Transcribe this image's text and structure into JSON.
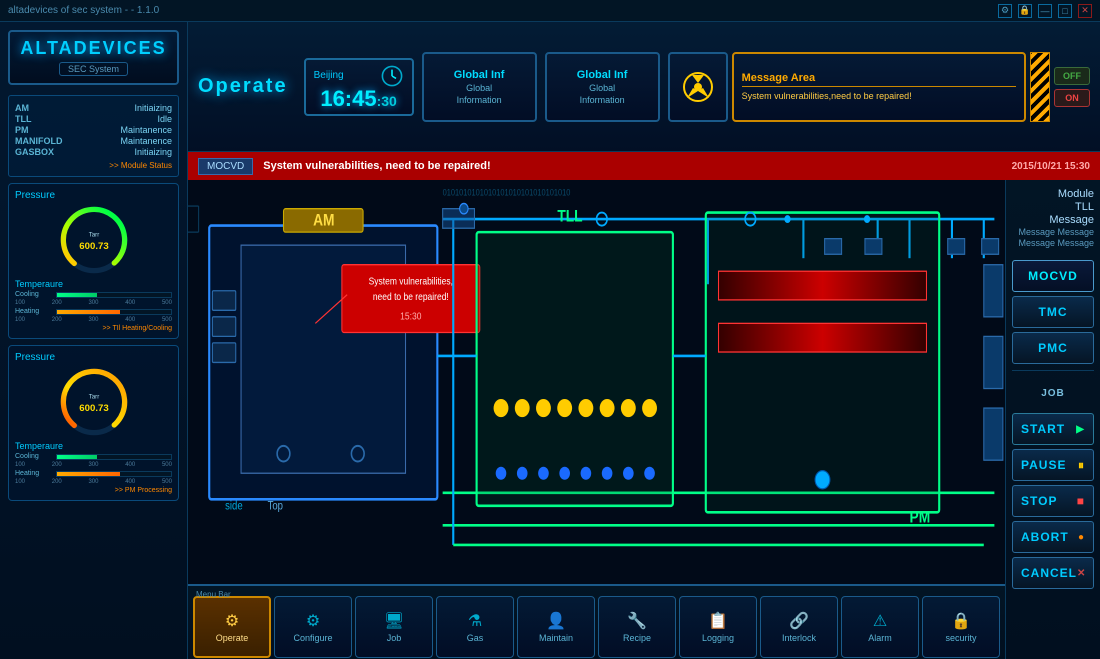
{
  "titlebar": {
    "system_text": "altadevices of sec system - - 1.1.0",
    "btn_settings": "⚙",
    "btn_lock": "🔒",
    "btn_minimize": "—",
    "btn_maximize": "□",
    "btn_close": "✕"
  },
  "header": {
    "operate_title": "Operate",
    "time": {
      "location": "Beijing",
      "hours": "16:45",
      "seconds": ":30"
    },
    "info_panel1": {
      "title": "Global Inf",
      "subtitle1": "Global",
      "subtitle2": "Information"
    },
    "info_panel2": {
      "title": "Global Inf",
      "subtitle1": "Global",
      "subtitle2": "Information"
    },
    "message_area": {
      "title": "Message Area",
      "text": "System vulnerabilities,need to be repaired!"
    },
    "off_label": "OFF",
    "on_label": "ON"
  },
  "alert_bar": {
    "label": "MOCVD",
    "message": "System vulnerabilities, need to be repaired!",
    "timestamp": "2015/10/21  15:30"
  },
  "left_sidebar": {
    "logo_title": "ALTADEVICES",
    "logo_subtitle": "SEC System",
    "modules": [
      {
        "name": "AM",
        "status": "Initiaizing"
      },
      {
        "name": "TLL",
        "status": "Idle"
      },
      {
        "name": "PM",
        "status": "Maintanence"
      },
      {
        "name": "MANIFOLD",
        "status": "Maintanence"
      },
      {
        "name": "GASBOX",
        "status": "Initiaizing"
      }
    ],
    "module_link": ">> Module Status",
    "pressure_panel1": {
      "title": "Pressure",
      "gauge_label": "Tarr",
      "gauge_value": "600.73",
      "temp_title": "Temperaure",
      "cooling_label": "Cooling",
      "heating_label": "Heating",
      "tick_labels": [
        "100",
        "200",
        "300",
        "400",
        "500"
      ],
      "footer_link": ">> TIl Heating/Cooling"
    },
    "pressure_panel2": {
      "title": "Pressure",
      "gauge_label": "Tarr",
      "gauge_value": "600.73",
      "temp_title": "Temperaure",
      "cooling_label": "Cooling",
      "heating_label": "Heating",
      "tick_labels": [
        "100",
        "200",
        "300",
        "400",
        "500"
      ],
      "footer_link": ">> PM Processing"
    }
  },
  "diagram": {
    "am_label": "AM",
    "am_alert": "System vulnerabilities,\nneed to be repaired!\n15:30",
    "am_side_label": "side",
    "am_top_label": "Top",
    "tll_label": "TLL",
    "pm_label": "PM"
  },
  "right_sidebar": {
    "module_title": "Module",
    "tll_title": "TLL",
    "message_title": "Message",
    "messages": [
      "Message Message",
      "Message Message"
    ],
    "buttons": {
      "mocvd": "MOCVD",
      "tmc": "TMC",
      "pmc": "PMC",
      "job": "JOB",
      "start": "START",
      "pause": "PAUSE",
      "stop": "STOP",
      "abort": "ABORT",
      "cancel": "CANCEL"
    }
  },
  "menu_bar": {
    "label": "Menu Bar",
    "items": [
      {
        "id": "operate",
        "label": "Operate",
        "icon": "⚙",
        "active": true
      },
      {
        "id": "configure",
        "label": "Configure",
        "icon": "⚙",
        "active": false
      },
      {
        "id": "job",
        "label": "Job",
        "icon": "🖥",
        "active": false
      },
      {
        "id": "gas",
        "label": "Gas",
        "icon": "⚗",
        "active": false
      },
      {
        "id": "maintain",
        "label": "Maintain",
        "icon": "👤",
        "active": false
      },
      {
        "id": "recipe",
        "label": "Recipe",
        "icon": "🔧",
        "active": false
      },
      {
        "id": "logging",
        "label": "Logging",
        "icon": "📋",
        "active": false
      },
      {
        "id": "interlock",
        "label": "Interlock",
        "icon": "🔗",
        "active": false
      },
      {
        "id": "alarm",
        "label": "Alarm",
        "icon": "⚠",
        "active": false
      },
      {
        "id": "security",
        "label": "security",
        "icon": "🔒",
        "active": false
      }
    ]
  }
}
